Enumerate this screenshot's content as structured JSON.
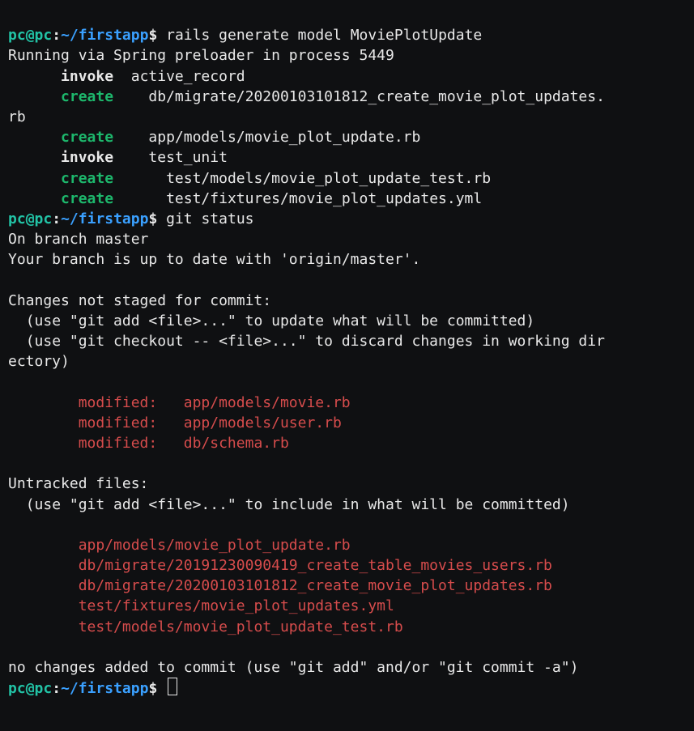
{
  "prompt": {
    "user": "pc",
    "at": "@",
    "host": "pc",
    "colon": ":",
    "path": "~/firstapp",
    "dollar": "$ "
  },
  "cmd1": "rails generate model MoviePlotUpdate",
  "rails": {
    "running": "Running via Spring preloader in process 5449",
    "l1": {
      "kw": "invoke",
      "rest": "  active_record"
    },
    "l2": {
      "kw": "create",
      "rest": "    db/migrate/20200103101812_create_movie_plot_updates."
    },
    "l2wrap": "rb",
    "l3": {
      "kw": "create",
      "rest": "    app/models/movie_plot_update.rb"
    },
    "l4": {
      "kw": "invoke",
      "rest": "    test_unit"
    },
    "l5": {
      "kw": "create",
      "rest": "      test/models/movie_plot_update_test.rb"
    },
    "l6": {
      "kw": "create",
      "rest": "      test/fixtures/movie_plot_updates.yml"
    }
  },
  "cmd2": "git status",
  "git": {
    "branch": "On branch master",
    "uptodate": "Your branch is up to date with 'origin/master'.",
    "blank": "",
    "nshdr": "Changes not staged for commit:",
    "nshelp1": "  (use \"git add <file>...\" to update what will be committed)",
    "nshelp2": "  (use \"git checkout -- <file>...\" to discard changes in working dir",
    "nshelp2wrap": "ectory)",
    "mod1": "        modified:   app/models/movie.rb",
    "mod2": "        modified:   app/models/user.rb",
    "mod3": "        modified:   db/schema.rb",
    "unhdr": "Untracked files:",
    "unhelp": "  (use \"git add <file>...\" to include in what will be committed)",
    "u1": "        app/models/movie_plot_update.rb",
    "u2": "        db/migrate/20191230090419_create_table_movies_users.rb",
    "u3": "        db/migrate/20200103101812_create_movie_plot_updates.rb",
    "u4": "        test/fixtures/movie_plot_updates.yml",
    "u5": "        test/models/movie_plot_update_test.rb",
    "foot": "no changes added to commit (use \"git add\" and/or \"git commit -a\")"
  },
  "indent6": "      "
}
